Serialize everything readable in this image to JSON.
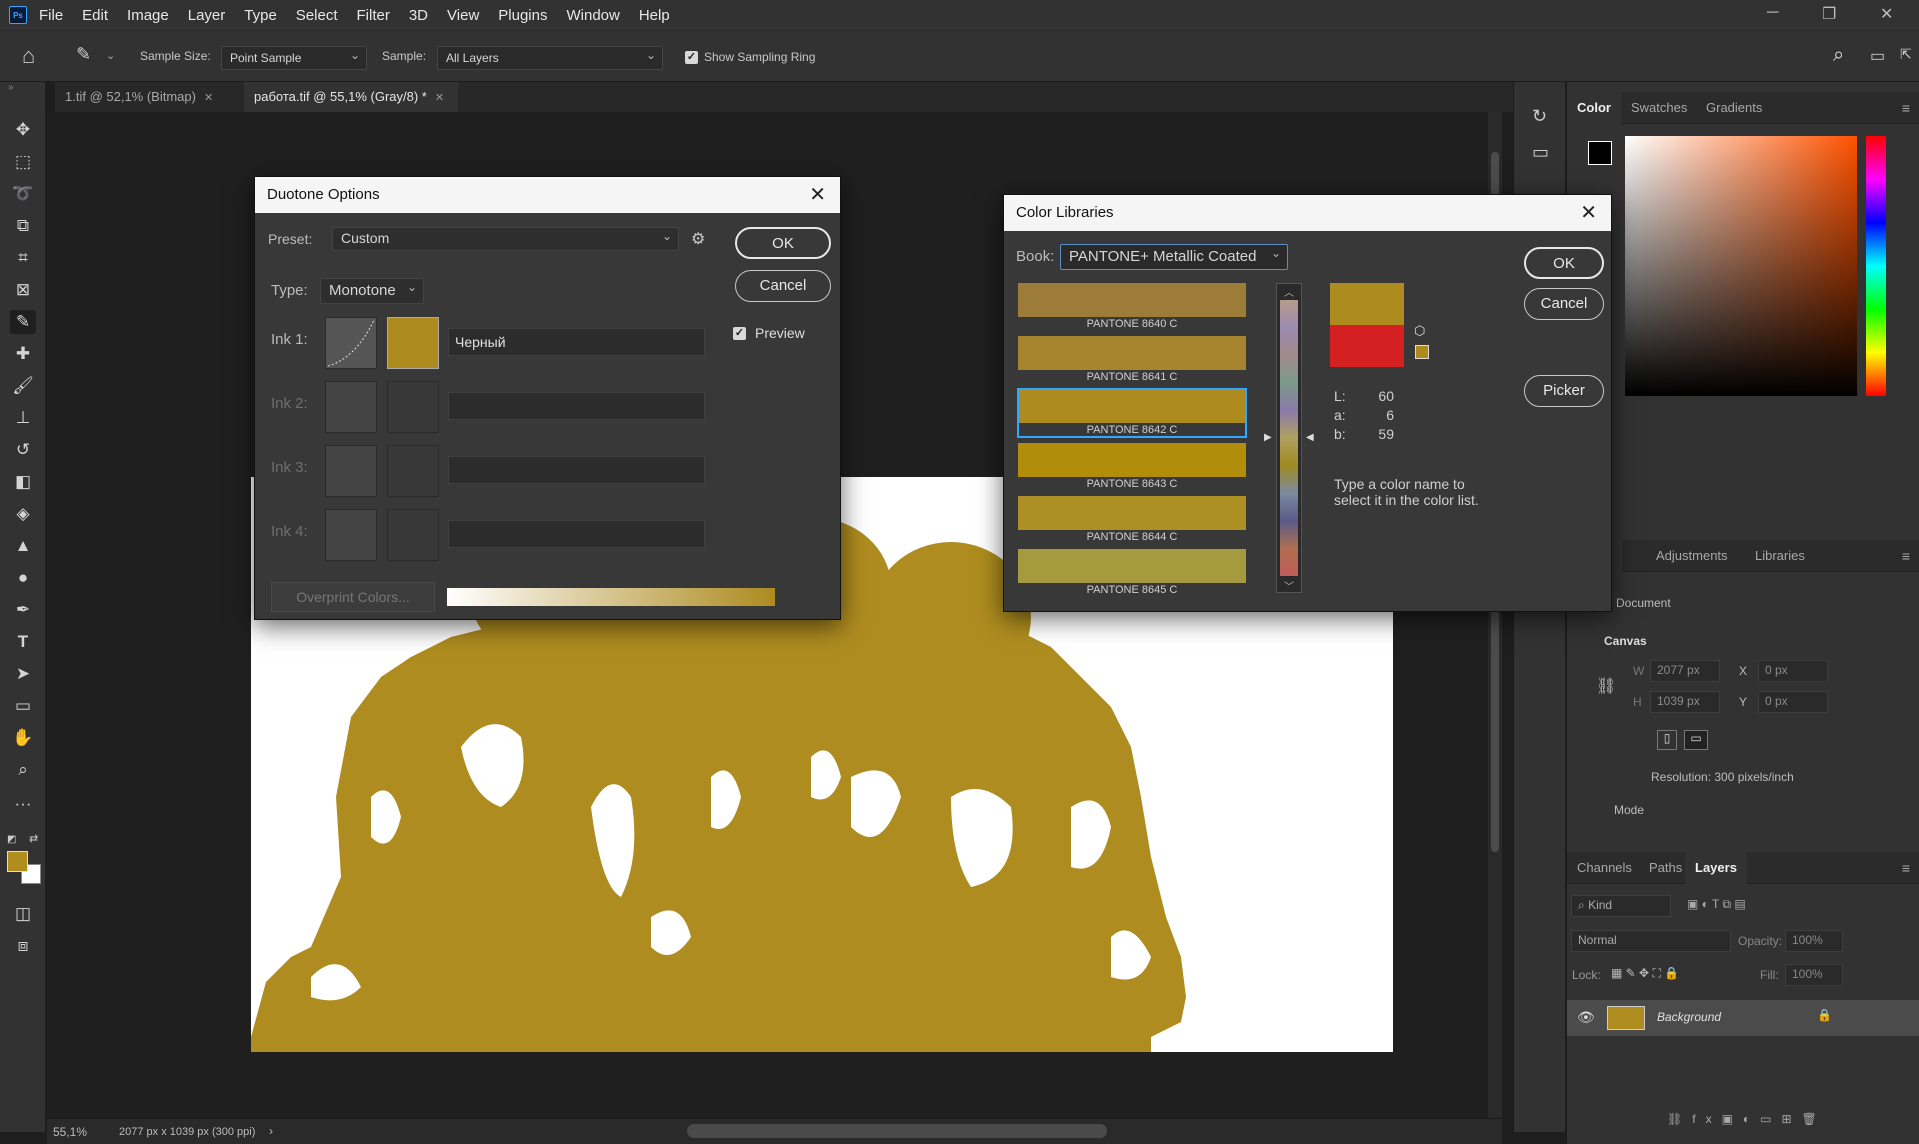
{
  "menu": {
    "logo": "Ps",
    "items": [
      "File",
      "Edit",
      "Image",
      "Layer",
      "Type",
      "Select",
      "Filter",
      "3D",
      "View",
      "Plugins",
      "Window",
      "Help"
    ]
  },
  "options": {
    "sample_size_label": "Sample Size:",
    "sample_size_value": "Point Sample",
    "sample_label": "Sample:",
    "sample_value": "All Layers",
    "sampling_ring_label": "Show Sampling Ring"
  },
  "tabs": [
    {
      "label": "1.tif @ 52,1% (Bitmap)"
    },
    {
      "label": "работа.tif @ 55,1% (Gray/8) *"
    }
  ],
  "colors": {
    "foreground": "#b08e1e",
    "ink": "#ad8b1f",
    "accent_highlight": "#31a8ff"
  },
  "status": {
    "zoom": "55,1%",
    "doc_info": "2077 px x 1039 px (300 ppi)"
  },
  "duotone": {
    "title": "Duotone Options",
    "preset_label": "Preset:",
    "preset_value": "Custom",
    "type_label": "Type:",
    "type_value": "Monotone",
    "ink1_label": "Ink 1:",
    "ink1_name": "Черный",
    "ink2_label": "Ink 2:",
    "ink3_label": "Ink 3:",
    "ink4_label": "Ink 4:",
    "overprint_label": "Overprint Colors...",
    "ok": "OK",
    "cancel": "Cancel",
    "preview": "Preview"
  },
  "colorlib": {
    "title": "Color Libraries",
    "book_label": "Book:",
    "book_value": "PANTONE+ Metallic Coated",
    "swatches": [
      {
        "name": "PANTONE 8640 C",
        "color": "#9d7b39"
      },
      {
        "name": "PANTONE 8641 C",
        "color": "#a7852e"
      },
      {
        "name": "PANTONE 8642 C",
        "color": "#ad8b1f"
      },
      {
        "name": "PANTONE 8643 C",
        "color": "#b08e0c"
      },
      {
        "name": "PANTONE 8644 C",
        "color": "#ac8f25"
      },
      {
        "name": "PANTONE 8645 C",
        "color": "#a59a3e"
      }
    ],
    "new_color": "#ad8b1f",
    "old_color": "#d42020",
    "L_label": "L:",
    "L": "60",
    "a_label": "a:",
    "a": "6",
    "b_label": "b:",
    "b": "59",
    "hint": "Type a color name to select it in the color list.",
    "ok": "OK",
    "cancel": "Cancel",
    "picker": "Picker"
  },
  "color_panel": {
    "tabs": [
      "Color",
      "Swatches",
      "Gradients"
    ]
  },
  "props_panel": {
    "tabs": [
      "erties",
      "Adjustments",
      "Libraries"
    ],
    "doc": "Document",
    "canvas": "Canvas",
    "w_label": "W",
    "w": "2077 px",
    "h_label": "H",
    "h": "1039 px",
    "x_label": "X",
    "x": "0 px",
    "y_label": "Y",
    "y": "0 px",
    "resolution": "Resolution: 300 pixels/inch",
    "mode": "Mode"
  },
  "layers_panel": {
    "tabs": [
      "Channels",
      "Paths",
      "Layers"
    ],
    "kind": "Kind",
    "blend": "Normal",
    "opacity_label": "Opacity:",
    "opacity": "100%",
    "lock_label": "Lock:",
    "fill_label": "Fill:",
    "fill": "100%",
    "layer_name": "Background"
  }
}
